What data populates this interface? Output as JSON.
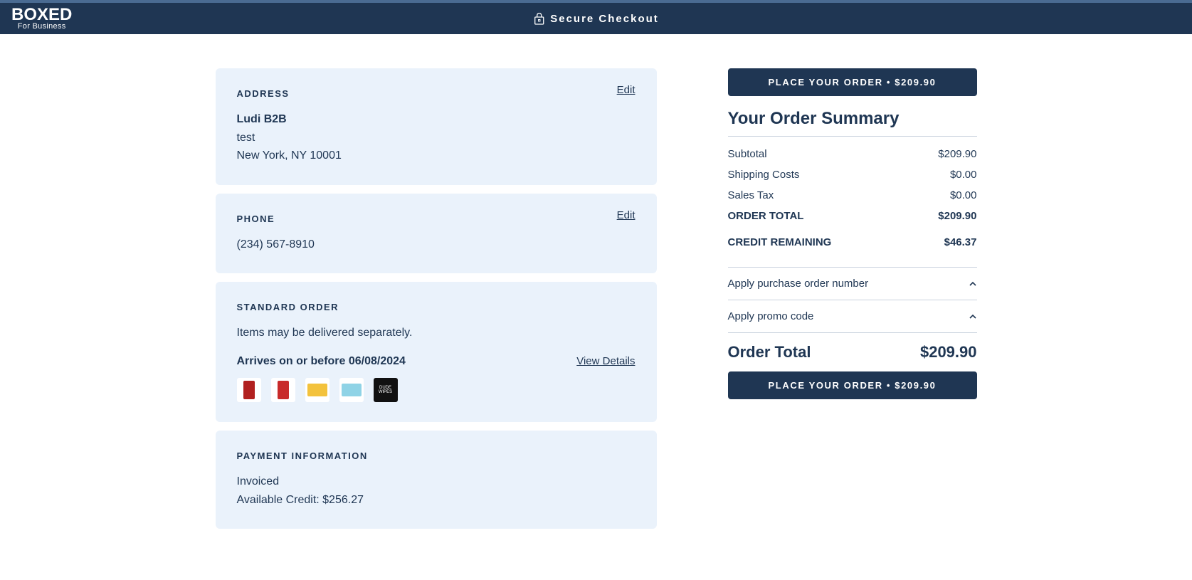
{
  "header": {
    "logo_main": "BOXED",
    "logo_sub": "For Business",
    "secure_text": "Secure Checkout"
  },
  "address": {
    "heading": "ADDRESS",
    "edit_label": "Edit",
    "name": "Ludi B2B",
    "line1": "test",
    "line2": "New York, NY 10001"
  },
  "phone": {
    "heading": "PHONE",
    "edit_label": "Edit",
    "value": "(234) 567-8910"
  },
  "shipment": {
    "heading": "STANDARD ORDER",
    "note": "Items may be delivered separately.",
    "arrives_label": "Arrives on or before 06/08/2024",
    "view_details_label": "View Details"
  },
  "payment": {
    "heading": "PAYMENT INFORMATION",
    "method": "Invoiced",
    "credit_line": "Available Credit: $256.27"
  },
  "summary": {
    "title": "Your Order Summary",
    "lines": {
      "subtotal_label": "Subtotal",
      "subtotal_value": "$209.90",
      "shipping_label": "Shipping Costs",
      "shipping_value": "$0.00",
      "tax_label": "Sales Tax",
      "tax_value": "$0.00",
      "order_total_label": "ORDER TOTAL",
      "order_total_value": "$209.90",
      "credit_remaining_label": "CREDIT REMAINING",
      "credit_remaining_value": "$46.37"
    },
    "collapsibles": {
      "po_label": "Apply purchase order number",
      "promo_label": "Apply promo code"
    },
    "grand_total_label": "Order Total",
    "grand_total_value": "$209.90",
    "place_order_label": "PLACE YOUR ORDER • $209.90"
  }
}
